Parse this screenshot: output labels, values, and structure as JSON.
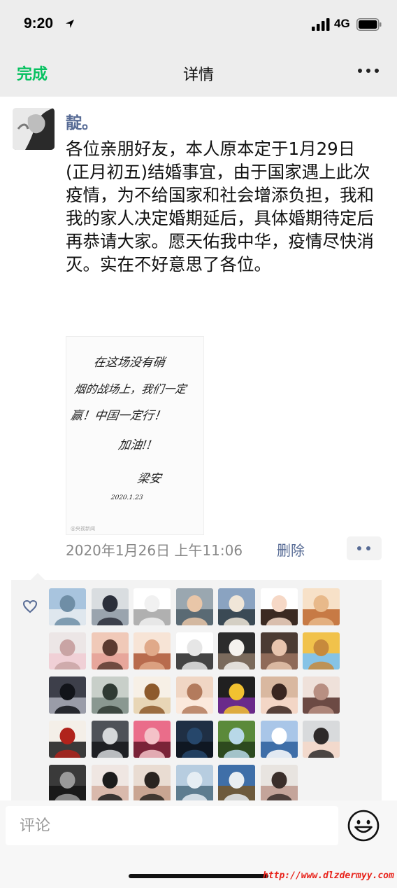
{
  "status_bar": {
    "time": "9:20",
    "network": "4G"
  },
  "nav": {
    "done_label": "完成",
    "title": "详情"
  },
  "post": {
    "username": "靛。",
    "text": "各位亲朋好友，本人原本定于1月29日\n(正月初五)结婚事宜，由于国家遇上此次疫情，为不给国家和社会增添负担，我和我的家人决定婚期延后，具体婚期待定后再恭请大家。愿天佑我中华，疫情尽快消灭。实在不好意思了各位。",
    "image": {
      "lines": [
        "在这场没有硝",
        "烟的战场上，我们一定",
        "赢！中国一定行！",
        "加油!!",
        "梁安",
        "2020.1.23"
      ],
      "watermark": "@央视新闻"
    },
    "date": "2020年1月26日 上午11:06",
    "delete_label": "删除"
  },
  "likes": {
    "avatars": [
      {
        "name": "like-avatar-1",
        "colors": [
          "#a8c4de",
          "#6f8ea6",
          "#dfe7ee"
        ]
      },
      {
        "name": "like-avatar-2",
        "colors": [
          "#d9dde0",
          "#2b2f3a",
          "#9aa4ae"
        ]
      },
      {
        "name": "like-avatar-3",
        "colors": [
          "#ffffff",
          "#f1f1f1",
          "#b0b0b0"
        ]
      },
      {
        "name": "like-avatar-4",
        "colors": [
          "#9aa7b0",
          "#e9c6a8",
          "#5a6a74"
        ]
      },
      {
        "name": "like-avatar-5",
        "colors": [
          "#8aa3c1",
          "#f0e6d8",
          "#3b4a55"
        ]
      },
      {
        "name": "like-avatar-6",
        "colors": [
          "#ffffff",
          "#f6d8c6",
          "#3b2a22"
        ]
      },
      {
        "name": "like-avatar-7",
        "colors": [
          "#f7e1c8",
          "#e8b98a",
          "#c77a45"
        ]
      },
      {
        "name": "like-avatar-8",
        "colors": [
          "#ece6e6",
          "#c9a4a4",
          "#f0d0d6"
        ]
      },
      {
        "name": "like-avatar-9",
        "colors": [
          "#f0c9b8",
          "#5b3a30",
          "#e7a69b"
        ]
      },
      {
        "name": "like-avatar-10",
        "colors": [
          "#f7e4d6",
          "#e0a989",
          "#b86b4d"
        ]
      },
      {
        "name": "like-avatar-11",
        "colors": [
          "#ffffff",
          "#e6e6e6",
          "#444444"
        ]
      },
      {
        "name": "like-avatar-12",
        "colors": [
          "#2c2c2c",
          "#f5f2ee",
          "#7a6a5c"
        ]
      },
      {
        "name": "like-avatar-13",
        "colors": [
          "#4b3b33",
          "#e8c5ae",
          "#8f6a58"
        ]
      },
      {
        "name": "like-avatar-14",
        "colors": [
          "#f1c24b",
          "#c78a3c",
          "#86c3e6"
        ]
      },
      {
        "name": "like-avatar-15",
        "colors": [
          "#3d3f4a",
          "#12141a",
          "#9a9ca8"
        ]
      },
      {
        "name": "like-avatar-16",
        "colors": [
          "#c8cfc9",
          "#2f3a33",
          "#8a9891"
        ]
      },
      {
        "name": "like-avatar-17",
        "colors": [
          "#f7f0e6",
          "#8d5a2c",
          "#e8d6b6"
        ]
      },
      {
        "name": "like-avatar-18",
        "colors": [
          "#f0d6c4",
          "#b37b5d",
          "#fbe9dc"
        ]
      },
      {
        "name": "like-avatar-19",
        "colors": [
          "#202020",
          "#f2c230",
          "#6a2a8a"
        ]
      },
      {
        "name": "like-avatar-20",
        "colors": [
          "#d9b8a0",
          "#3a2620",
          "#f3d6c6"
        ]
      },
      {
        "name": "like-avatar-21",
        "colors": [
          "#efe1da",
          "#b88f82",
          "#6c4a44"
        ]
      },
      {
        "name": "like-avatar-22",
        "colors": [
          "#f4efe8",
          "#b0231c",
          "#3a3a3a"
        ]
      },
      {
        "name": "like-avatar-23",
        "colors": [
          "#4e5258",
          "#d5d8da",
          "#1e2024"
        ]
      },
      {
        "name": "like-avatar-24",
        "colors": [
          "#ea6d8a",
          "#f4c2c8",
          "#7a2338"
        ]
      },
      {
        "name": "like-avatar-25",
        "colors": [
          "#1f2f44",
          "#26476b",
          "#0f1722"
        ]
      },
      {
        "name": "like-avatar-26",
        "colors": [
          "#5b8a3a",
          "#b8d8e8",
          "#2d4a1e"
        ]
      },
      {
        "name": "like-avatar-27",
        "colors": [
          "#a9c6e8",
          "#ffffff",
          "#3e6ea8"
        ]
      },
      {
        "name": "like-avatar-28",
        "colors": [
          "#d8dadc",
          "#2e2a2a",
          "#f2d9cc"
        ]
      },
      {
        "name": "like-avatar-29",
        "colors": [
          "#3a3a3a",
          "#9a9a9a",
          "#1a1a1a"
        ]
      },
      {
        "name": "like-avatar-30",
        "colors": [
          "#efe6e2",
          "#1c1c1c",
          "#d9b9ac"
        ]
      },
      {
        "name": "like-avatar-31",
        "colors": [
          "#e9dcd2",
          "#2a2420",
          "#c9a592"
        ]
      },
      {
        "name": "like-avatar-32",
        "colors": [
          "#b7cde0",
          "#e6eef4",
          "#5d7c8f"
        ]
      },
      {
        "name": "like-avatar-33",
        "colors": [
          "#3f6fa8",
          "#e9eef2",
          "#6d5a3c"
        ]
      },
      {
        "name": "like-avatar-34",
        "colors": [
          "#e8e4e0",
          "#3a2e2a",
          "#c4a49a"
        ]
      }
    ]
  },
  "comment": {
    "placeholder": "评论"
  },
  "watermark": "http://www.dlzdermyy.com"
}
